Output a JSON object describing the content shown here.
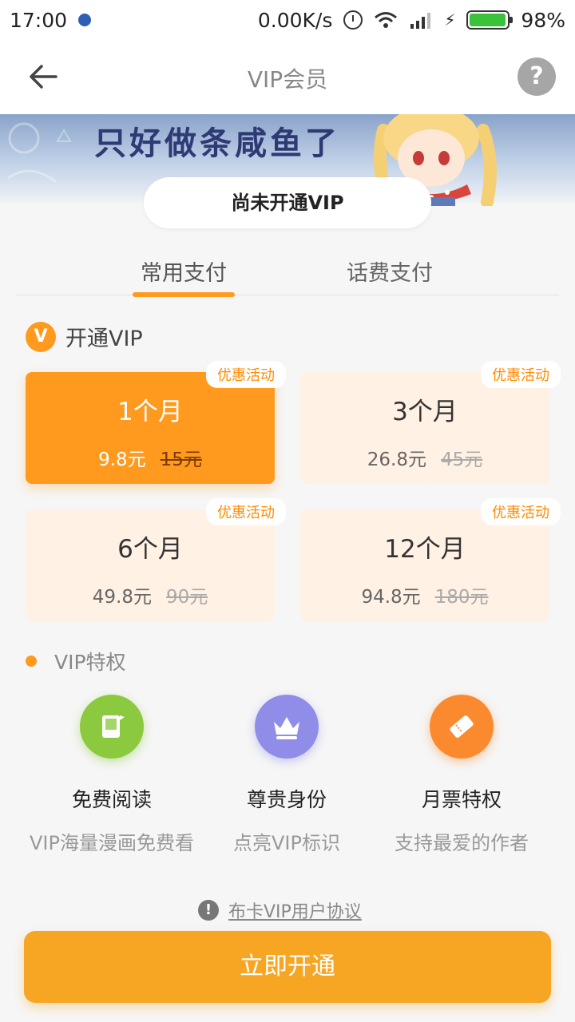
{
  "status_bar": {
    "time": "17:00",
    "network_speed": "0.00K/s",
    "battery_percent": "98%",
    "battery_level": 0.98
  },
  "nav": {
    "title": "VIP会员",
    "help_label": "?"
  },
  "banner": {
    "text": "只好做条咸鱼了"
  },
  "vip_status": "尚未开通VIP",
  "tabs": [
    {
      "label": "常用支付",
      "active": true
    },
    {
      "label": "话费支付",
      "active": false
    }
  ],
  "plans_section": {
    "badge": "V",
    "label": "开通VIP"
  },
  "plans": [
    {
      "tag": "优惠活动",
      "duration": "1个月",
      "price": "9.8元",
      "original_price": "15元",
      "selected": true
    },
    {
      "tag": "优惠活动",
      "duration": "3个月",
      "price": "26.8元",
      "original_price": "45元",
      "selected": false
    },
    {
      "tag": "优惠活动",
      "duration": "6个月",
      "price": "49.8元",
      "original_price": "90元",
      "selected": false
    },
    {
      "tag": "优惠活动",
      "duration": "12个月",
      "price": "94.8元",
      "original_price": "180元",
      "selected": false
    }
  ],
  "privileges_section": {
    "label": "VIP特权"
  },
  "privileges": [
    {
      "title": "免费阅读",
      "description": "VIP海量漫画免费看",
      "icon": "book-icon",
      "color": "#8bc93f"
    },
    {
      "title": "尊贵身份",
      "description": "点亮VIP标识",
      "icon": "crown-icon",
      "color": "#8f8de8"
    },
    {
      "title": "月票特权",
      "description": "支持最爱的作者",
      "icon": "ticket-icon",
      "color": "#fb8a2e"
    }
  ],
  "agreement": {
    "icon_label": "!",
    "text": "布卡VIP用户协议"
  },
  "cta": {
    "label": "立即开通"
  },
  "colors": {
    "accent": "#ff9a1f",
    "cta": "#f6a623",
    "plan_bg": "#fff1e3"
  }
}
